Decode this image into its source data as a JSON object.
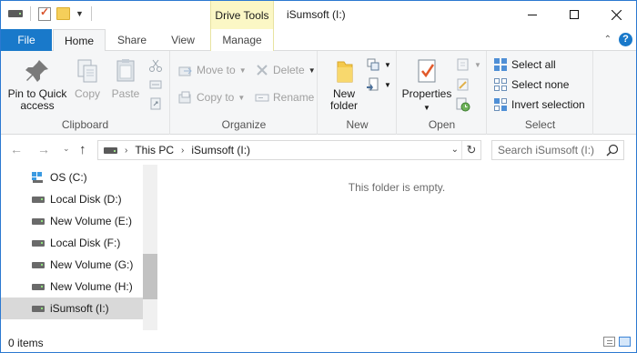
{
  "titlebar": {
    "context_tab": "Drive Tools",
    "title": "iSumsoft (I:)"
  },
  "tabs": {
    "file": "File",
    "home": "Home",
    "share": "Share",
    "view": "View",
    "manage": "Manage"
  },
  "ribbon": {
    "clipboard": {
      "label": "Clipboard",
      "pin_line1": "Pin to Quick",
      "pin_line2": "access",
      "copy": "Copy",
      "paste": "Paste"
    },
    "organize": {
      "label": "Organize",
      "move_to": "Move to",
      "copy_to": "Copy to",
      "delete": "Delete",
      "rename": "Rename"
    },
    "new": {
      "label": "New",
      "new_folder_line1": "New",
      "new_folder_line2": "folder"
    },
    "open": {
      "label": "Open",
      "properties": "Properties"
    },
    "select": {
      "label": "Select",
      "select_all": "Select all",
      "select_none": "Select none",
      "invert_selection": "Invert selection"
    }
  },
  "address": {
    "crumbs": [
      "This PC",
      "iSumsoft (I:)"
    ],
    "search_placeholder": "Search iSumsoft (I:)"
  },
  "nav_pane": {
    "items": [
      {
        "label": "OS (C:)",
        "icon": "os-drive-icon"
      },
      {
        "label": "Local Disk (D:)",
        "icon": "drive-icon"
      },
      {
        "label": "New Volume (E:)",
        "icon": "drive-icon"
      },
      {
        "label": "Local Disk (F:)",
        "icon": "drive-icon"
      },
      {
        "label": "New Volume (G:)",
        "icon": "drive-icon"
      },
      {
        "label": "New Volume (H:)",
        "icon": "drive-icon"
      },
      {
        "label": "iSumsoft (I:)",
        "icon": "drive-icon",
        "selected": true
      }
    ]
  },
  "content": {
    "empty_message": "This folder is empty."
  },
  "status": {
    "item_count": "0 items"
  },
  "colors": {
    "accent": "#1979ca",
    "context_tab": "#fbf7c5",
    "selected_item": "#d9d9d9"
  }
}
